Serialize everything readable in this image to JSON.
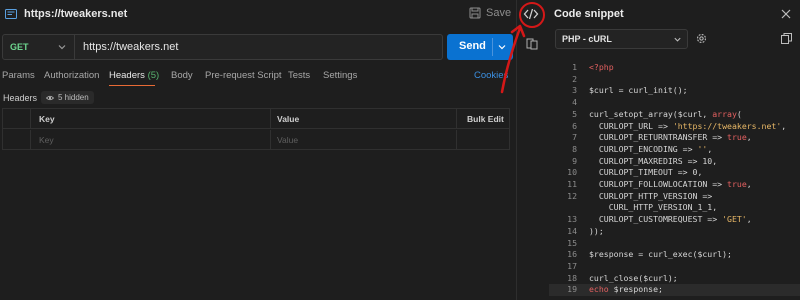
{
  "request": {
    "title": "https://tweakers.net",
    "save_label": "Save",
    "method": "GET",
    "url": "https://tweakers.net",
    "send_label": "Send"
  },
  "tabs": [
    {
      "label": "Params"
    },
    {
      "label": "Authorization"
    },
    {
      "label": "Headers",
      "count": "(5)"
    },
    {
      "label": "Body"
    },
    {
      "label": "Pre-request Script"
    },
    {
      "label": "Tests"
    },
    {
      "label": "Settings"
    },
    {
      "label": "Cookies"
    }
  ],
  "headers_section": {
    "label": "Headers",
    "hidden_badge": "5 hidden",
    "columns": [
      "Key",
      "Value",
      "Bulk Edit"
    ],
    "placeholders": {
      "key": "Key",
      "value": "Value"
    }
  },
  "snippet": {
    "title": "Code snippet",
    "language": "PHP - cURL",
    "lines": [
      {
        "n": "1",
        "tokens": [
          {
            "t": "<?php",
            "c": "kw"
          }
        ]
      },
      {
        "n": "2",
        "tokens": []
      },
      {
        "n": "3",
        "tokens": [
          {
            "t": "$curl = curl_init();",
            "c": ""
          }
        ]
      },
      {
        "n": "4",
        "tokens": []
      },
      {
        "n": "5",
        "tokens": [
          {
            "t": "curl_setopt_array($curl, ",
            "c": ""
          },
          {
            "t": "array",
            "c": "kw"
          },
          {
            "t": "(",
            "c": ""
          }
        ]
      },
      {
        "n": "6",
        "tokens": [
          {
            "t": "  CURLOPT_URL => ",
            "c": ""
          },
          {
            "t": "'https://tweakers.net'",
            "c": "str"
          },
          {
            "t": ",",
            "c": ""
          }
        ]
      },
      {
        "n": "7",
        "tokens": [
          {
            "t": "  CURLOPT_RETURNTRANSFER => ",
            "c": ""
          },
          {
            "t": "true",
            "c": "kw"
          },
          {
            "t": ",",
            "c": ""
          }
        ]
      },
      {
        "n": "8",
        "tokens": [
          {
            "t": "  CURLOPT_ENCODING => ",
            "c": ""
          },
          {
            "t": "''",
            "c": "str"
          },
          {
            "t": ",",
            "c": ""
          }
        ]
      },
      {
        "n": "9",
        "tokens": [
          {
            "t": "  CURLOPT_MAXREDIRS => 10,",
            "c": ""
          }
        ]
      },
      {
        "n": "10",
        "tokens": [
          {
            "t": "  CURLOPT_TIMEOUT => 0,",
            "c": ""
          }
        ]
      },
      {
        "n": "11",
        "tokens": [
          {
            "t": "  CURLOPT_FOLLOWLOCATION => ",
            "c": ""
          },
          {
            "t": "true",
            "c": "kw"
          },
          {
            "t": ",",
            "c": ""
          }
        ]
      },
      {
        "n": "12",
        "tokens": [
          {
            "t": "  CURLOPT_HTTP_VERSION =>",
            "c": ""
          }
        ]
      },
      {
        "n": "",
        "tokens": [
          {
            "t": "    CURL_HTTP_VERSION_1_1,",
            "c": ""
          }
        ]
      },
      {
        "n": "13",
        "tokens": [
          {
            "t": "  CURLOPT_CUSTOMREQUEST => ",
            "c": ""
          },
          {
            "t": "'GET'",
            "c": "str"
          },
          {
            "t": ",",
            "c": ""
          }
        ]
      },
      {
        "n": "14",
        "tokens": [
          {
            "t": "));",
            "c": ""
          }
        ]
      },
      {
        "n": "15",
        "tokens": []
      },
      {
        "n": "16",
        "tokens": [
          {
            "t": "$response = curl_exec($curl);",
            "c": ""
          }
        ]
      },
      {
        "n": "17",
        "tokens": []
      },
      {
        "n": "18",
        "tokens": [
          {
            "t": "curl_close($curl);",
            "c": ""
          }
        ]
      },
      {
        "n": "19",
        "tokens": [
          {
            "t": "echo",
            "c": "kw"
          },
          {
            "t": " $response;",
            "c": ""
          }
        ]
      }
    ]
  },
  "colors": {
    "accent_blue": "#0a72d1",
    "method_green": "#6ed68f",
    "active_tab_underline": "#e86a35",
    "annotation_red": "#d41818"
  },
  "icons": [
    "request-icon",
    "save-icon",
    "chevron-down-icon",
    "eye-off-icon",
    "code-icon",
    "document-icon",
    "close-icon",
    "gear-icon",
    "copy-icon"
  ]
}
